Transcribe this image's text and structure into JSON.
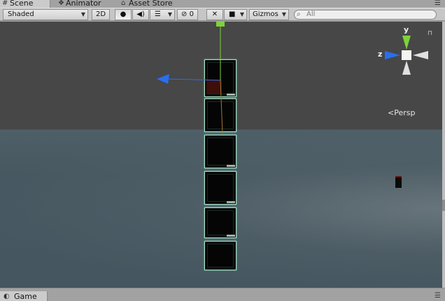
{
  "tabs": [
    {
      "label": "Scene",
      "icon": "hash-icon"
    },
    {
      "label": "Animator",
      "icon": "animator-icon"
    },
    {
      "label": "Asset Store",
      "icon": "store-icon"
    }
  ],
  "toolbar": {
    "shading_mode": "Shaded",
    "mode_2d": "2D",
    "hidden_count": "0",
    "gizmos_label": "Gizmos",
    "search_placeholder": "All"
  },
  "scene": {
    "orientation": {
      "y_label": "y",
      "z_label": "z",
      "projection_label": "Persp"
    },
    "colors": {
      "x_axis": "#e8e8e8",
      "y_axis": "#7ed23a",
      "z_axis": "#2a6ef0",
      "selection_outline": "#a8e2c8"
    }
  },
  "bottom": {
    "game_tab": "Game"
  }
}
